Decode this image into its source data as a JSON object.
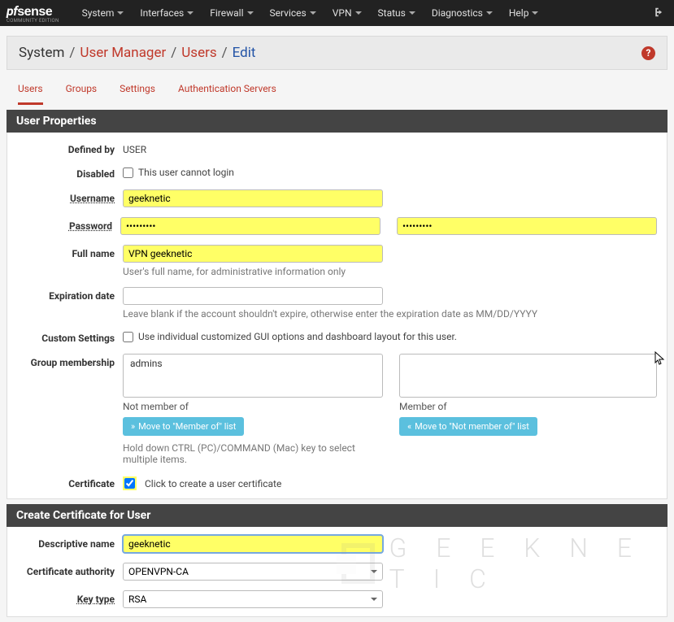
{
  "nav": {
    "items": [
      "System",
      "Interfaces",
      "Firewall",
      "Services",
      "VPN",
      "Status",
      "Diagnostics",
      "Help"
    ],
    "logo": "pfsense",
    "logoSub": "COMMUNITY EDITION"
  },
  "breadcrumb": {
    "a": "System",
    "b": "User Manager",
    "c": "Users",
    "d": "Edit"
  },
  "tabs": [
    "Users",
    "Groups",
    "Settings",
    "Authentication Servers"
  ],
  "panel1": "User Properties",
  "panel2": "Create Certificate for User",
  "labels": {
    "definedBy": "Defined by",
    "disabled": "Disabled",
    "username": "Username",
    "password": "Password",
    "fullname": "Full name",
    "expiration": "Expiration date",
    "custom": "Custom Settings",
    "group": "Group membership",
    "cert": "Certificate",
    "descname": "Descriptive name",
    "ca": "Certificate authority",
    "keytype": "Key type"
  },
  "values": {
    "definedBy": "USER",
    "disabledLabel": "This user cannot login",
    "username": "geeknetic",
    "password": "•••••••••",
    "password2": "•••••••••",
    "fullname": "VPN geeknetic",
    "fullnameHint": "User's full name, for administrative information only",
    "expiration": "",
    "expirationHint": "Leave blank if the account shouldn't expire, otherwise enter the expiration date as MM/DD/YYYY",
    "customLabel": "Use individual customized GUI options and dashboard layout for this user.",
    "groupNotMember": "admins",
    "groupNotMemberLbl": "Not member of",
    "groupMemberLbl": "Member of",
    "moveRight": "Move to \"Member of\" list",
    "moveLeft": "Move to \"Not member of\" list",
    "groupHint": "Hold down CTRL (PC)/COMMAND (Mac) key to select multiple items.",
    "certLabel": "Click to create a user certificate",
    "descname": "geeknetic",
    "ca": "OPENVPN-CA",
    "keytype": "RSA"
  },
  "watermark": "G E E K N E T I C"
}
